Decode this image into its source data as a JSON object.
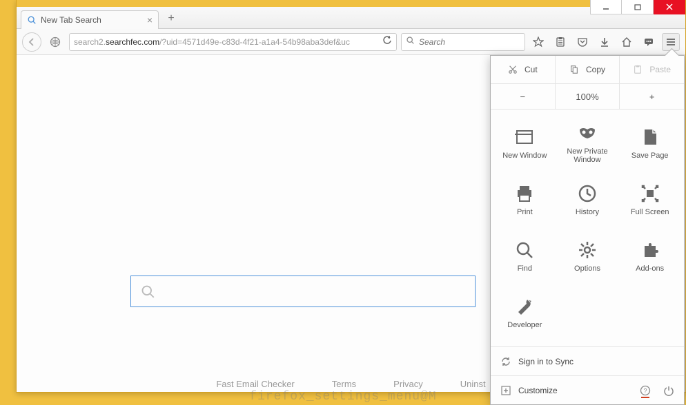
{
  "window": {
    "controls": {
      "min": "minimize",
      "max": "maximize",
      "close": "close"
    }
  },
  "tab": {
    "title": "New Tab Search",
    "close": "×",
    "newtab": "+"
  },
  "url": {
    "prefix": "search2.",
    "domain": "searchfec.com",
    "path": "/?uid=4571d49e-c83d-4f21-a1a4-54b98aba3def&uc"
  },
  "searchbar": {
    "placeholder": "Search"
  },
  "menu": {
    "edit": {
      "cut": "Cut",
      "copy": "Copy",
      "paste": "Paste"
    },
    "zoom": {
      "out": "−",
      "value": "100%",
      "in": "+"
    },
    "items": [
      {
        "label": "New Window"
      },
      {
        "label": "New Private Window"
      },
      {
        "label": "Save Page"
      },
      {
        "label": "Print"
      },
      {
        "label": "History"
      },
      {
        "label": "Full Screen"
      },
      {
        "label": "Find"
      },
      {
        "label": "Options"
      },
      {
        "label": "Add-ons"
      },
      {
        "label": "Developer"
      }
    ],
    "sync": "Sign in to Sync",
    "customize": "Customize"
  },
  "footer": {
    "links": [
      "Fast Email Checker",
      "Terms",
      "Privacy",
      "Uninst"
    ]
  },
  "watermark": "firefox_settings_menu@M"
}
